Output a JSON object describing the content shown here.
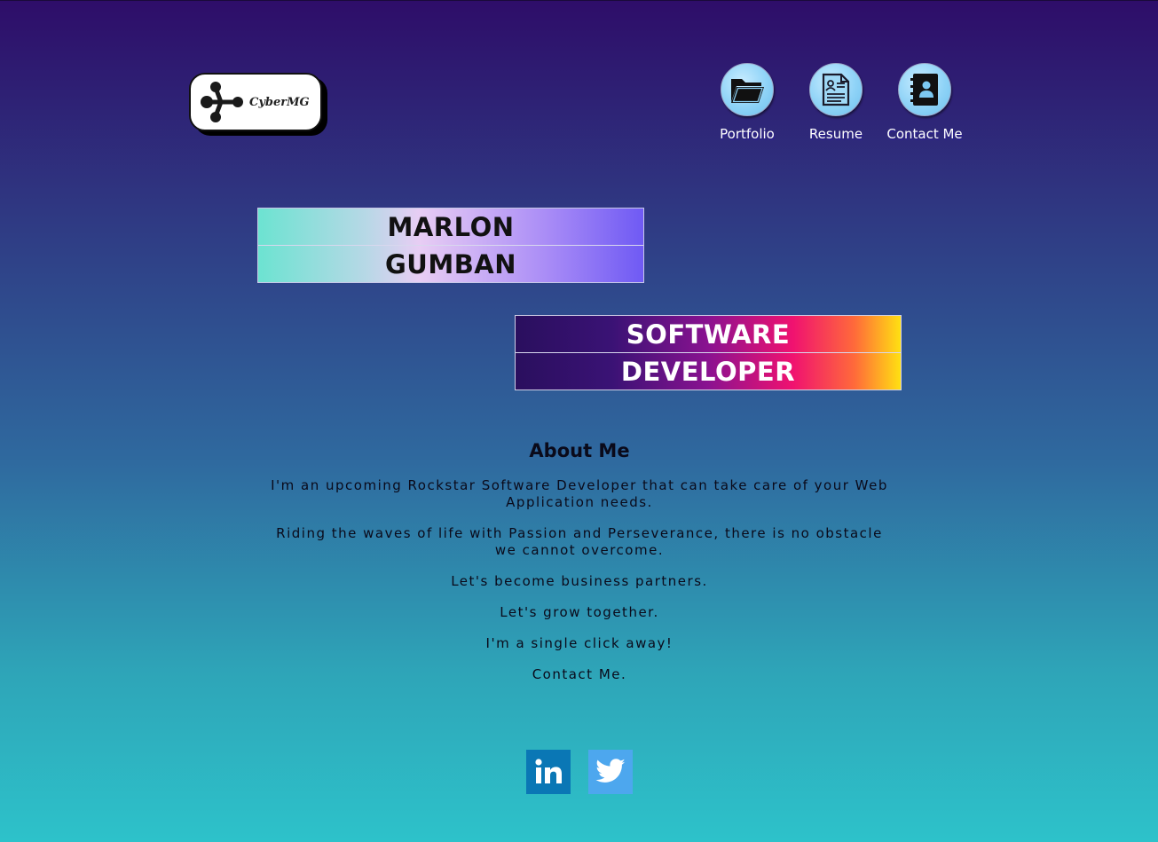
{
  "header": {
    "logo_text": "CyberMG",
    "nav": [
      {
        "label": "Portfolio",
        "icon": "folder-icon"
      },
      {
        "label": "Resume",
        "icon": "document-icon"
      },
      {
        "label": "Contact Me",
        "icon": "contact-book-icon"
      }
    ]
  },
  "hero": {
    "first_name": "MARLON",
    "last_name": "GUMBAN",
    "role_line1": "SOFTWARE",
    "role_line2": "DEVELOPER"
  },
  "about": {
    "title": "About Me",
    "paragraphs": [
      "I'm an upcoming Rockstar Software Developer that can take care of your Web Application needs.",
      "Riding the waves of life with Passion and Perseverance, there is no obstacle we cannot overcome.",
      "Let's become business partners.",
      "Let's grow together.",
      "I'm a single click away!",
      "Contact Me."
    ]
  },
  "social": [
    {
      "name": "linkedin-icon",
      "color": "#0a77b5"
    },
    {
      "name": "twitter-icon",
      "color": "#4da7ee"
    }
  ]
}
